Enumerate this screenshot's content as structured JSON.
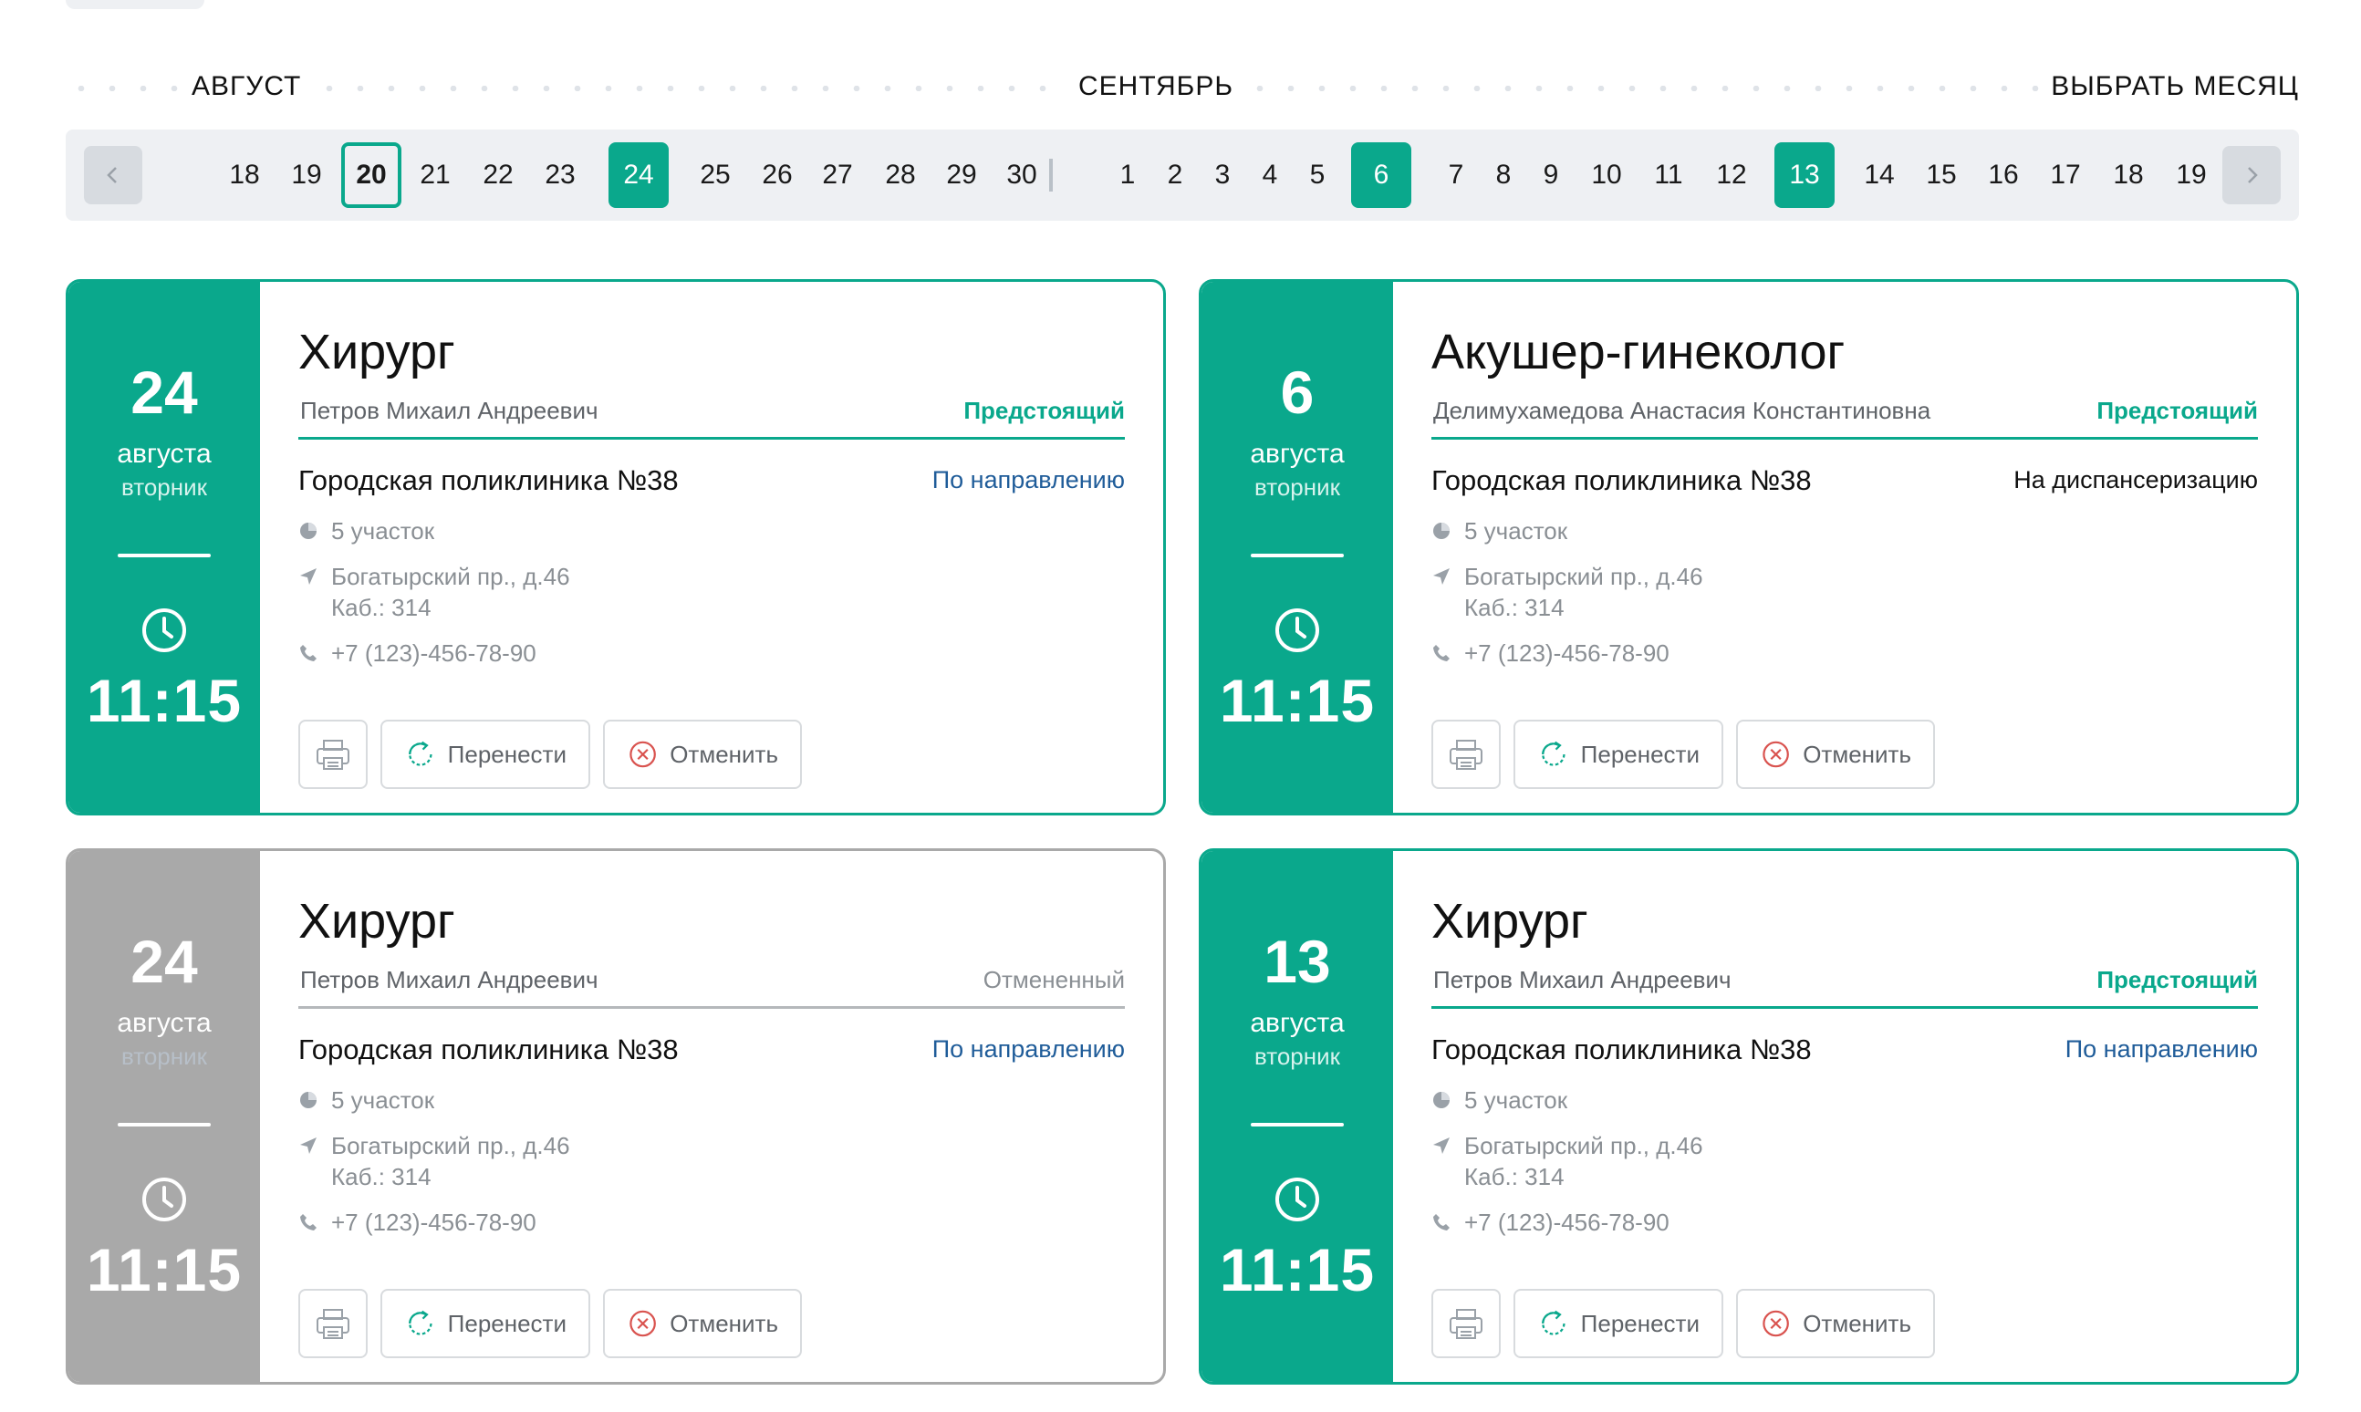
{
  "calendar": {
    "months": {
      "left": "АВГУСТ",
      "center": "СЕНТЯБРЬ",
      "pick": "ВЫБРАТЬ МЕСЯЦ"
    },
    "days": [
      {
        "n": "18"
      },
      {
        "n": "19"
      },
      {
        "n": "20",
        "state": "today"
      },
      {
        "n": "21"
      },
      {
        "n": "22"
      },
      {
        "n": "23"
      },
      {
        "n": "24",
        "state": "active"
      },
      {
        "n": "25"
      },
      {
        "n": "26"
      },
      {
        "n": "27"
      },
      {
        "n": "28"
      },
      {
        "n": "29"
      },
      {
        "n": "30"
      },
      {
        "n": "1"
      },
      {
        "n": "2"
      },
      {
        "n": "3"
      },
      {
        "n": "4"
      },
      {
        "n": "5"
      },
      {
        "n": "6",
        "state": "active"
      },
      {
        "n": "7"
      },
      {
        "n": "8"
      },
      {
        "n": "9"
      },
      {
        "n": "10"
      },
      {
        "n": "11"
      },
      {
        "n": "12"
      },
      {
        "n": "13",
        "state": "active"
      },
      {
        "n": "14"
      },
      {
        "n": "15"
      },
      {
        "n": "16"
      },
      {
        "n": "17"
      },
      {
        "n": "18"
      },
      {
        "n": "19"
      }
    ]
  },
  "colors": {
    "accent": "#0aa88c",
    "cancelled": "#a9a9a9",
    "link": "#1f5c99"
  },
  "appointments": [
    {
      "day": "24",
      "month": "августа",
      "weekday": "вторник",
      "time": "11:15",
      "specialty": "Хирург",
      "doctor": "Петров Михаил Андреевич",
      "status": "Предстоящий",
      "clinic": "Городская поликлиника №38",
      "referral": "По направлению",
      "district": "5 участок",
      "address": "Богатырский пр., д.46",
      "room": "Каб.: 314",
      "phone": "+7 (123)-456-78-90",
      "move_label": "Перенести",
      "cancel_label": "Отменить"
    },
    {
      "day": "6",
      "month": "августа",
      "weekday": "вторник",
      "time": "11:15",
      "specialty": "Акушер-гинеколог",
      "doctor": "Делимухамедова Анастасия Константиновна",
      "status": "Предстоящий",
      "clinic": "Городская поликлиника №38",
      "referral": "На диспансеризацию",
      "district": "5 участок",
      "address": "Богатырский пр., д.46",
      "room": "Каб.: 314",
      "phone": "+7 (123)-456-78-90",
      "move_label": "Перенести",
      "cancel_label": "Отменить"
    },
    {
      "day": "24",
      "month": "августа",
      "weekday": "вторник",
      "time": "11:15",
      "specialty": "Хирург",
      "doctor": "Петров Михаил Андреевич",
      "status": "Отмененный",
      "clinic": "Городская поликлиника №38",
      "referral": "По направлению",
      "district": "5 участок",
      "address": "Богатырский пр., д.46",
      "room": "Каб.: 314",
      "phone": "+7 (123)-456-78-90",
      "move_label": "Перенести",
      "cancel_label": "Отменить"
    },
    {
      "day": "13",
      "month": "августа",
      "weekday": "вторник",
      "time": "11:15",
      "specialty": "Хирург",
      "doctor": "Петров Михаил Андреевич",
      "status": "Предстоящий",
      "clinic": "Городская поликлиника №38",
      "referral": "По направлению",
      "district": "5 участок",
      "address": "Богатырский пр., д.46",
      "room": "Каб.: 314",
      "phone": "+7 (123)-456-78-90",
      "move_label": "Перенести",
      "cancel_label": "Отменить"
    }
  ]
}
